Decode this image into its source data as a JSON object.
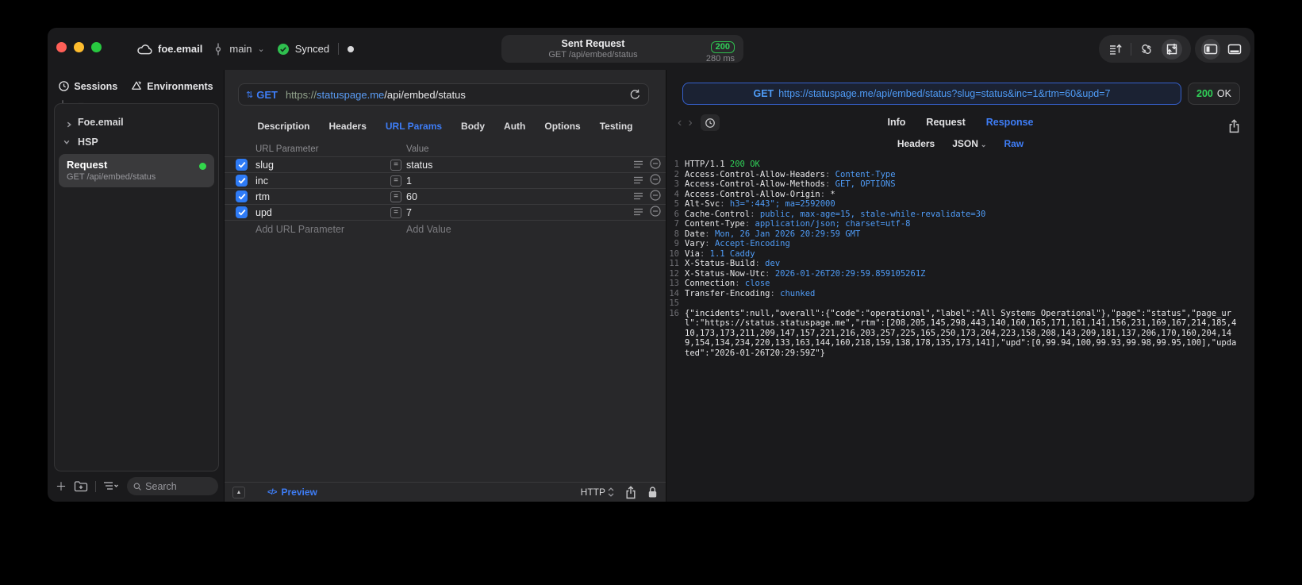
{
  "colors": {
    "accent_blue": "#3e7df6",
    "code_value_blue": "#4f9cf7",
    "status_green": "#30d158",
    "url_scheme_green": "#93a48d",
    "traffic_red": "#ff5f57",
    "traffic_yellow": "#febc2e",
    "traffic_green": "#28c840"
  },
  "titlebar": {
    "project": "foe.email",
    "branch": "main",
    "sync_label": "Synced",
    "request_pill": {
      "title": "Sent Request",
      "subtitle": "GET /api/embed/status",
      "status_code": "200",
      "duration": "280 ms"
    }
  },
  "sidebar": {
    "tabs": [
      {
        "label": "Sessions",
        "icon": "clock-icon"
      },
      {
        "label": "Environments",
        "icon": "environments-icon"
      }
    ],
    "tree": [
      {
        "label": "Foe.email",
        "expanded": false
      },
      {
        "label": "HSP",
        "expanded": true
      }
    ],
    "request_item": {
      "title": "Request",
      "subtitle": "GET /api/embed/status"
    },
    "search": {
      "placeholder": "Search"
    }
  },
  "request_editor": {
    "method": "GET",
    "url": {
      "scheme": "https://",
      "host": "statuspage.me",
      "path": "/api/embed/status"
    },
    "tabs": [
      "Description",
      "Headers",
      "URL Params",
      "Body",
      "Auth",
      "Options",
      "Testing"
    ],
    "active_tab": "URL Params",
    "params": {
      "columns": [
        "URL Parameter",
        "Value"
      ],
      "rows": [
        {
          "name": "slug",
          "value": "status",
          "enabled": true
        },
        {
          "name": "inc",
          "value": "1",
          "enabled": true
        },
        {
          "name": "rtm",
          "value": "60",
          "enabled": true
        },
        {
          "name": "upd",
          "value": "7",
          "enabled": true
        }
      ],
      "add_name_placeholder": "Add URL Parameter",
      "add_value_placeholder": "Add Value"
    },
    "footer": {
      "preview_label": "Preview",
      "protocol": "HTTP"
    }
  },
  "response_viewer": {
    "request_line": {
      "method": "GET",
      "url": "https://statuspage.me/api/embed/status?slug=status&inc=1&rtm=60&upd=7"
    },
    "status": {
      "code": "200",
      "label": "OK"
    },
    "tabs": [
      "Info",
      "Request",
      "Response"
    ],
    "active_tab": "Response",
    "subtabs": [
      "Headers",
      "JSON",
      "Raw"
    ],
    "active_subtab": "Raw",
    "status_line": {
      "protocol": "HTTP/1.1",
      "status": "200 OK"
    },
    "headers": [
      {
        "name": "Access-Control-Allow-Headers",
        "value": "Content-Type"
      },
      {
        "name": "Access-Control-Allow-Methods",
        "value": "GET, OPTIONS"
      },
      {
        "name": "Access-Control-Allow-Origin",
        "value": "*",
        "plain": true
      },
      {
        "name": "Alt-Svc",
        "value": "h3=\":443\"; ma=2592000"
      },
      {
        "name": "Cache-Control",
        "value": "public, max-age=15, stale-while-revalidate=30"
      },
      {
        "name": "Content-Type",
        "value": "application/json; charset=utf-8"
      },
      {
        "name": "Date",
        "value": "Mon, 26 Jan 2026 20:29:59 GMT"
      },
      {
        "name": "Vary",
        "value": "Accept-Encoding"
      },
      {
        "name": "Via",
        "value": "1.1 Caddy"
      },
      {
        "name": "X-Status-Build",
        "value": "dev"
      },
      {
        "name": "X-Status-Now-Utc",
        "value": "2026-01-26T20:29:59.859105261Z"
      },
      {
        "name": "Connection",
        "value": "close"
      },
      {
        "name": "Transfer-Encoding",
        "value": "chunked"
      }
    ],
    "body": "{\"incidents\":null,\"overall\":{\"code\":\"operational\",\"label\":\"All Systems Operational\"},\"page\":\"status\",\"page_url\":\"https://status.statuspage.me\",\"rtm\":[208,205,145,298,443,140,160,165,171,161,141,156,231,169,167,214,185,410,173,173,211,209,147,157,221,216,203,257,225,165,250,173,204,223,158,208,143,209,181,137,206,170,160,204,149,154,134,234,220,133,163,144,160,218,159,138,178,135,173,141],\"upd\":[0,99.94,100,99.93,99.98,99.95,100],\"updated\":\"2026-01-26T20:29:59Z\"}"
  }
}
